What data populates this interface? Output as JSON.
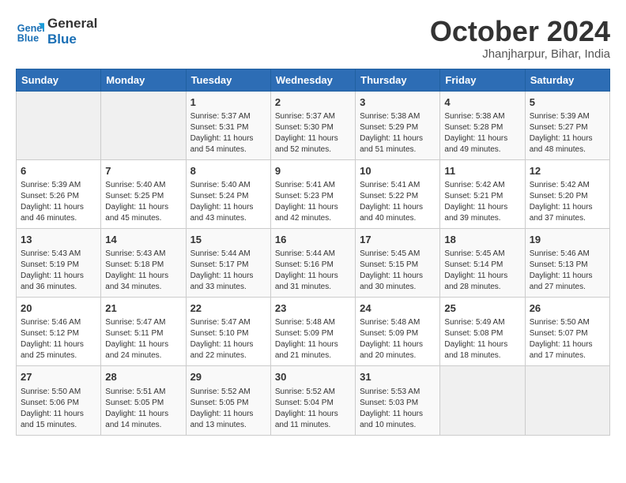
{
  "logo": {
    "line1": "General",
    "line2": "Blue"
  },
  "title": "October 2024",
  "subtitle": "Jhanjharpur, Bihar, India",
  "headers": [
    "Sunday",
    "Monday",
    "Tuesday",
    "Wednesday",
    "Thursday",
    "Friday",
    "Saturday"
  ],
  "weeks": [
    [
      {
        "day": "",
        "sunrise": "",
        "sunset": "",
        "daylight": ""
      },
      {
        "day": "",
        "sunrise": "",
        "sunset": "",
        "daylight": ""
      },
      {
        "day": "1",
        "sunrise": "Sunrise: 5:37 AM",
        "sunset": "Sunset: 5:31 PM",
        "daylight": "Daylight: 11 hours and 54 minutes."
      },
      {
        "day": "2",
        "sunrise": "Sunrise: 5:37 AM",
        "sunset": "Sunset: 5:30 PM",
        "daylight": "Daylight: 11 hours and 52 minutes."
      },
      {
        "day": "3",
        "sunrise": "Sunrise: 5:38 AM",
        "sunset": "Sunset: 5:29 PM",
        "daylight": "Daylight: 11 hours and 51 minutes."
      },
      {
        "day": "4",
        "sunrise": "Sunrise: 5:38 AM",
        "sunset": "Sunset: 5:28 PM",
        "daylight": "Daylight: 11 hours and 49 minutes."
      },
      {
        "day": "5",
        "sunrise": "Sunrise: 5:39 AM",
        "sunset": "Sunset: 5:27 PM",
        "daylight": "Daylight: 11 hours and 48 minutes."
      }
    ],
    [
      {
        "day": "6",
        "sunrise": "Sunrise: 5:39 AM",
        "sunset": "Sunset: 5:26 PM",
        "daylight": "Daylight: 11 hours and 46 minutes."
      },
      {
        "day": "7",
        "sunrise": "Sunrise: 5:40 AM",
        "sunset": "Sunset: 5:25 PM",
        "daylight": "Daylight: 11 hours and 45 minutes."
      },
      {
        "day": "8",
        "sunrise": "Sunrise: 5:40 AM",
        "sunset": "Sunset: 5:24 PM",
        "daylight": "Daylight: 11 hours and 43 minutes."
      },
      {
        "day": "9",
        "sunrise": "Sunrise: 5:41 AM",
        "sunset": "Sunset: 5:23 PM",
        "daylight": "Daylight: 11 hours and 42 minutes."
      },
      {
        "day": "10",
        "sunrise": "Sunrise: 5:41 AM",
        "sunset": "Sunset: 5:22 PM",
        "daylight": "Daylight: 11 hours and 40 minutes."
      },
      {
        "day": "11",
        "sunrise": "Sunrise: 5:42 AM",
        "sunset": "Sunset: 5:21 PM",
        "daylight": "Daylight: 11 hours and 39 minutes."
      },
      {
        "day": "12",
        "sunrise": "Sunrise: 5:42 AM",
        "sunset": "Sunset: 5:20 PM",
        "daylight": "Daylight: 11 hours and 37 minutes."
      }
    ],
    [
      {
        "day": "13",
        "sunrise": "Sunrise: 5:43 AM",
        "sunset": "Sunset: 5:19 PM",
        "daylight": "Daylight: 11 hours and 36 minutes."
      },
      {
        "day": "14",
        "sunrise": "Sunrise: 5:43 AM",
        "sunset": "Sunset: 5:18 PM",
        "daylight": "Daylight: 11 hours and 34 minutes."
      },
      {
        "day": "15",
        "sunrise": "Sunrise: 5:44 AM",
        "sunset": "Sunset: 5:17 PM",
        "daylight": "Daylight: 11 hours and 33 minutes."
      },
      {
        "day": "16",
        "sunrise": "Sunrise: 5:44 AM",
        "sunset": "Sunset: 5:16 PM",
        "daylight": "Daylight: 11 hours and 31 minutes."
      },
      {
        "day": "17",
        "sunrise": "Sunrise: 5:45 AM",
        "sunset": "Sunset: 5:15 PM",
        "daylight": "Daylight: 11 hours and 30 minutes."
      },
      {
        "day": "18",
        "sunrise": "Sunrise: 5:45 AM",
        "sunset": "Sunset: 5:14 PM",
        "daylight": "Daylight: 11 hours and 28 minutes."
      },
      {
        "day": "19",
        "sunrise": "Sunrise: 5:46 AM",
        "sunset": "Sunset: 5:13 PM",
        "daylight": "Daylight: 11 hours and 27 minutes."
      }
    ],
    [
      {
        "day": "20",
        "sunrise": "Sunrise: 5:46 AM",
        "sunset": "Sunset: 5:12 PM",
        "daylight": "Daylight: 11 hours and 25 minutes."
      },
      {
        "day": "21",
        "sunrise": "Sunrise: 5:47 AM",
        "sunset": "Sunset: 5:11 PM",
        "daylight": "Daylight: 11 hours and 24 minutes."
      },
      {
        "day": "22",
        "sunrise": "Sunrise: 5:47 AM",
        "sunset": "Sunset: 5:10 PM",
        "daylight": "Daylight: 11 hours and 22 minutes."
      },
      {
        "day": "23",
        "sunrise": "Sunrise: 5:48 AM",
        "sunset": "Sunset: 5:09 PM",
        "daylight": "Daylight: 11 hours and 21 minutes."
      },
      {
        "day": "24",
        "sunrise": "Sunrise: 5:48 AM",
        "sunset": "Sunset: 5:09 PM",
        "daylight": "Daylight: 11 hours and 20 minutes."
      },
      {
        "day": "25",
        "sunrise": "Sunrise: 5:49 AM",
        "sunset": "Sunset: 5:08 PM",
        "daylight": "Daylight: 11 hours and 18 minutes."
      },
      {
        "day": "26",
        "sunrise": "Sunrise: 5:50 AM",
        "sunset": "Sunset: 5:07 PM",
        "daylight": "Daylight: 11 hours and 17 minutes."
      }
    ],
    [
      {
        "day": "27",
        "sunrise": "Sunrise: 5:50 AM",
        "sunset": "Sunset: 5:06 PM",
        "daylight": "Daylight: 11 hours and 15 minutes."
      },
      {
        "day": "28",
        "sunrise": "Sunrise: 5:51 AM",
        "sunset": "Sunset: 5:05 PM",
        "daylight": "Daylight: 11 hours and 14 minutes."
      },
      {
        "day": "29",
        "sunrise": "Sunrise: 5:52 AM",
        "sunset": "Sunset: 5:05 PM",
        "daylight": "Daylight: 11 hours and 13 minutes."
      },
      {
        "day": "30",
        "sunrise": "Sunrise: 5:52 AM",
        "sunset": "Sunset: 5:04 PM",
        "daylight": "Daylight: 11 hours and 11 minutes."
      },
      {
        "day": "31",
        "sunrise": "Sunrise: 5:53 AM",
        "sunset": "Sunset: 5:03 PM",
        "daylight": "Daylight: 11 hours and 10 minutes."
      },
      {
        "day": "",
        "sunrise": "",
        "sunset": "",
        "daylight": ""
      },
      {
        "day": "",
        "sunrise": "",
        "sunset": "",
        "daylight": ""
      }
    ]
  ]
}
